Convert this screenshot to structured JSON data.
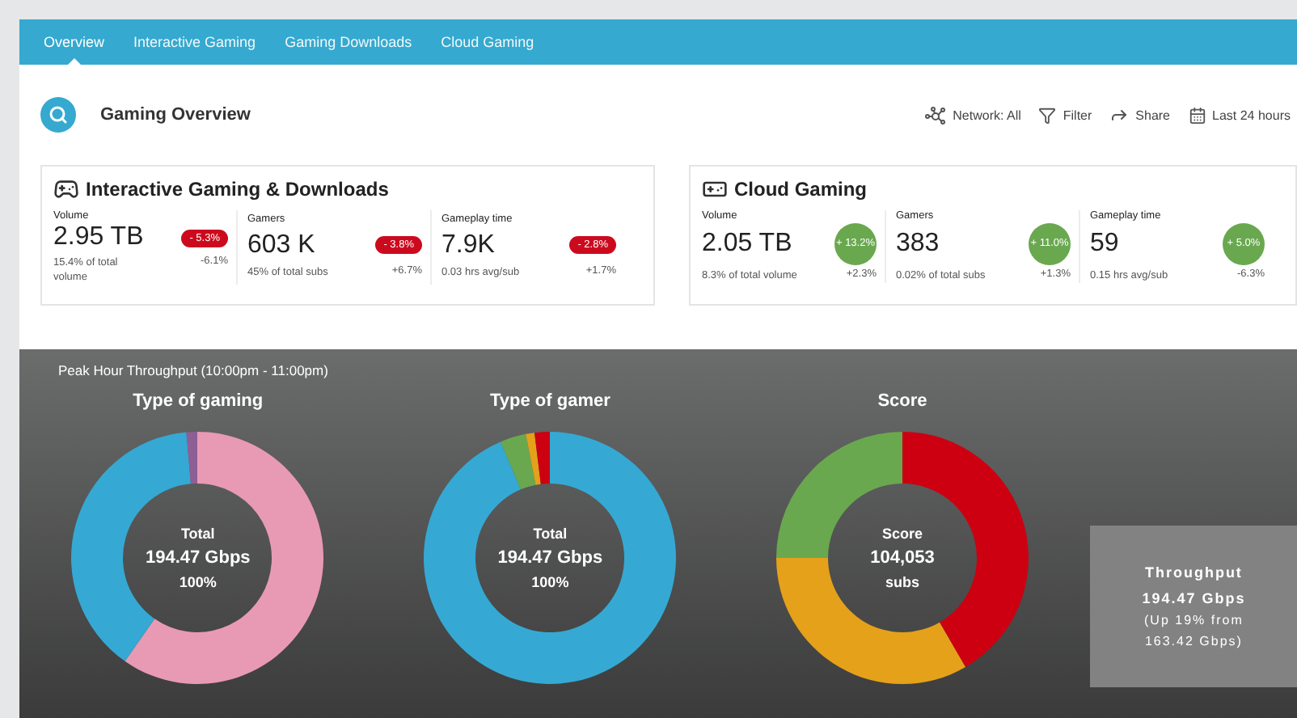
{
  "tabs": [
    {
      "label": "Overview",
      "selected": true
    },
    {
      "label": "Interactive Gaming",
      "selected": false
    },
    {
      "label": "Gaming Downloads",
      "selected": false
    },
    {
      "label": "Cloud Gaming",
      "selected": false
    }
  ],
  "header": {
    "title": "Gaming Overview",
    "actions": [
      {
        "label": "Network: All"
      },
      {
        "label": "Filter"
      },
      {
        "label": "Share"
      },
      {
        "label": "Last 24 hours"
      }
    ]
  },
  "cards": [
    {
      "title": "Interactive Gaming & Downloads",
      "kind": "pill",
      "stats": [
        {
          "label": "Volume",
          "value": "2.95 TB",
          "change": "- 5.3%",
          "note": "15.4% of total volume",
          "delta": "-6.1%"
        },
        {
          "label": "Gamers",
          "value": "603 K",
          "change": "- 3.8%",
          "note": "45% of total subs",
          "delta": "+6.7%"
        },
        {
          "label": "Gameplay time",
          "value": "7.9K",
          "change": "- 2.8%",
          "note": "0.03 hrs avg/sub",
          "delta": "+1.7%"
        }
      ]
    },
    {
      "title": "Cloud Gaming",
      "kind": "circle",
      "stats": [
        {
          "label": "Volume",
          "value": "2.05 TB",
          "change": "+ 13.2%",
          "note": "8.3% of total volume",
          "delta": "+2.3%"
        },
        {
          "label": "Gamers",
          "value": "383",
          "change": "+ 11.0%",
          "note": "0.02% of total subs",
          "delta": "+1.3%"
        },
        {
          "label": "Gameplay time",
          "value": "59",
          "change": "+ 5.0%",
          "note": "0.15 hrs avg/sub",
          "delta": "-6.3%"
        }
      ]
    }
  ],
  "panel": {
    "title": "Peak Hour Throughput (10:00pm - 11:00pm)",
    "donuts": [
      {
        "title": "Type of gaming",
        "kind": "gaming",
        "center": [
          "Total",
          "194.47 Gbps",
          "100%"
        ]
      },
      {
        "title": "Type of gamer",
        "kind": "gamer",
        "center": [
          "Total",
          "194.47 Gbps",
          "100%"
        ]
      },
      {
        "title": "Score",
        "kind": "score",
        "center": [
          "Score",
          "104,053",
          "subs"
        ]
      }
    ],
    "summary": {
      "title": "Throughput",
      "lines": [
        "194.47 Gbps",
        "(Up 19% from",
        "163.42 Gbps)"
      ]
    }
  }
}
